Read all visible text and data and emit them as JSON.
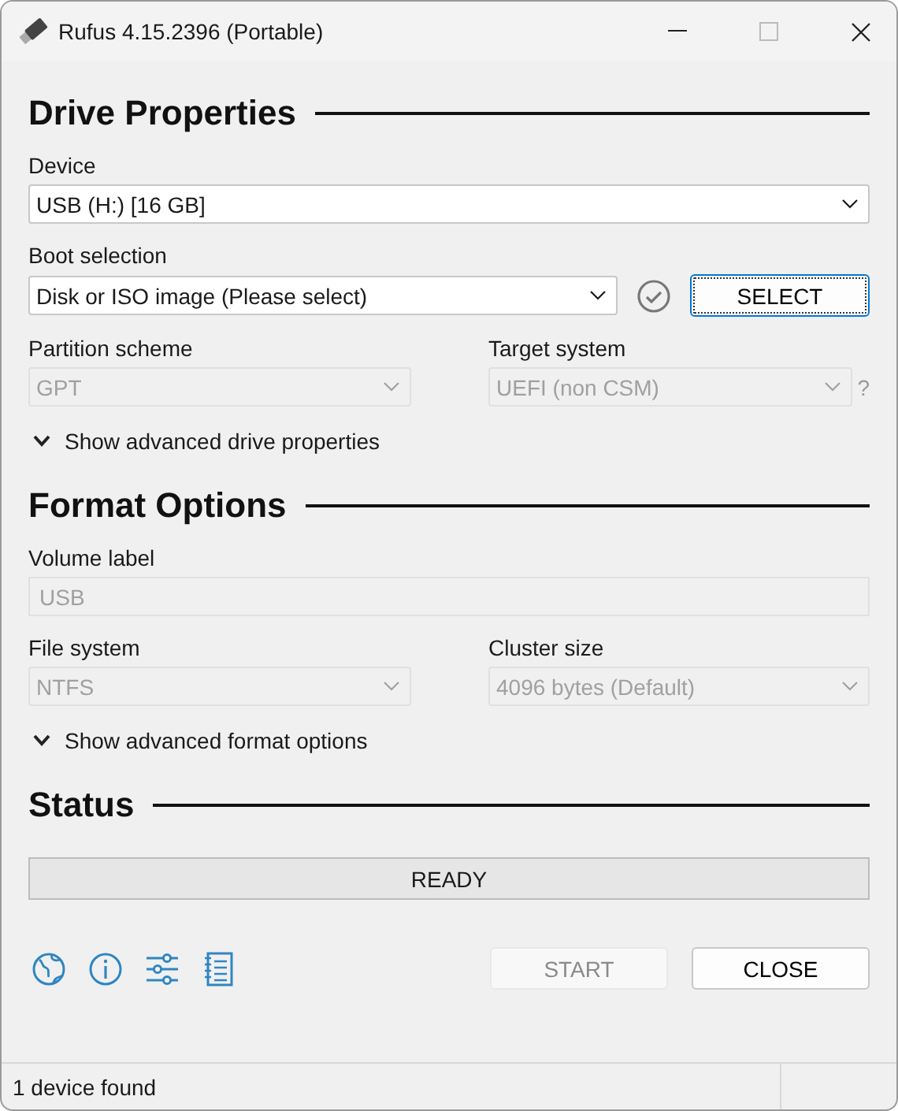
{
  "window": {
    "title": "Rufus 4.15.2396 (Portable)"
  },
  "drive_properties": {
    "heading": "Drive Properties",
    "device": {
      "label": "Device",
      "value": "USB (H:) [16 GB]",
      "disabled": false
    },
    "boot_selection": {
      "label": "Boot selection",
      "value": "Disk or ISO image (Please select)",
      "disabled": false,
      "verified": false,
      "select_button": "SELECT"
    },
    "partition_scheme": {
      "label": "Partition scheme",
      "value": "GPT",
      "disabled": true
    },
    "target_system": {
      "label": "Target system",
      "value": "UEFI (non CSM)",
      "disabled": true,
      "help": "?"
    },
    "advanced": {
      "label": "Show advanced drive properties",
      "expanded": false
    }
  },
  "format_options": {
    "heading": "Format Options",
    "volume_label": {
      "label": "Volume label",
      "value": "USB",
      "disabled": true
    },
    "file_system": {
      "label": "File system",
      "value": "NTFS",
      "disabled": true
    },
    "cluster_size": {
      "label": "Cluster size",
      "value": "4096 bytes (Default)",
      "disabled": true
    },
    "advanced": {
      "label": "Show advanced format options",
      "expanded": false
    }
  },
  "status": {
    "heading": "Status",
    "progress": {
      "text": "READY"
    }
  },
  "toolbar": [
    {
      "kind": "language"
    },
    {
      "kind": "about"
    },
    {
      "kind": "settings"
    },
    {
      "kind": "log"
    }
  ],
  "buttons": [
    {
      "label": "START",
      "disabled": true
    },
    {
      "label": "CLOSE",
      "disabled": false
    }
  ],
  "status_bar": {
    "text": "1 device found"
  }
}
